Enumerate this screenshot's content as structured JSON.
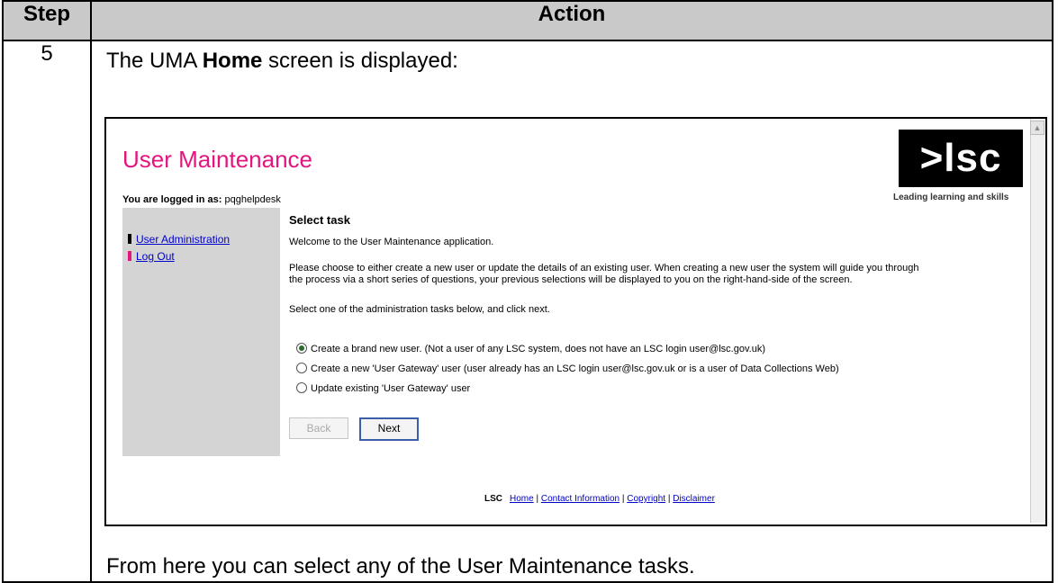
{
  "table": {
    "header_step": "Step",
    "header_action": "Action",
    "step_number": "5",
    "intro_prefix": "The UMA ",
    "intro_bold": "Home",
    "intro_suffix": " screen is displayed:",
    "outro": "From here you can select any of the User Maintenance tasks."
  },
  "screenshot": {
    "app_title": "User Maintenance",
    "logo_text": ">lsc",
    "tagline": "Leading learning and skills",
    "logged_label": "You are logged in as:",
    "logged_user": " pqghelpdesk",
    "sidebar": {
      "items": [
        {
          "label": "User Administration",
          "bar_color": "#000000"
        },
        {
          "label": "Log Out",
          "bar_color": "#e4157e"
        }
      ]
    },
    "main": {
      "heading": "Select task",
      "welcome": "Welcome to the User Maintenance application.",
      "desc_line1": "Please choose to either create a new user or update the details of an existing user. When creating a new user the system will guide you through",
      "desc_line2": "the process via a short series of questions, your previous selections will be displayed to you on the right-hand-side of the screen.",
      "instruction": "Select one of the administration tasks below, and click next.",
      "options": [
        {
          "label": "Create a brand new user. (Not a user of any LSC system, does not have an LSC login user@lsc.gov.uk)",
          "selected": true
        },
        {
          "label": "Create a new 'User Gateway' user (user already has an LSC login user@lsc.gov.uk or is a user of Data Collections Web)",
          "selected": false
        },
        {
          "label": "Update existing 'User Gateway' user",
          "selected": false
        }
      ],
      "back_label": "Back",
      "next_label": "Next"
    },
    "footer": {
      "brand": "LSC",
      "links": [
        "Home",
        "Contact Information",
        "Copyright",
        "Disclaimer"
      ],
      "separator": " | "
    }
  },
  "colors": {
    "title_magenta": "#e4157e",
    "sidebar_bg": "#d4d4d4",
    "header_bg": "#c9c9c9",
    "link_blue": "#0000cc"
  }
}
